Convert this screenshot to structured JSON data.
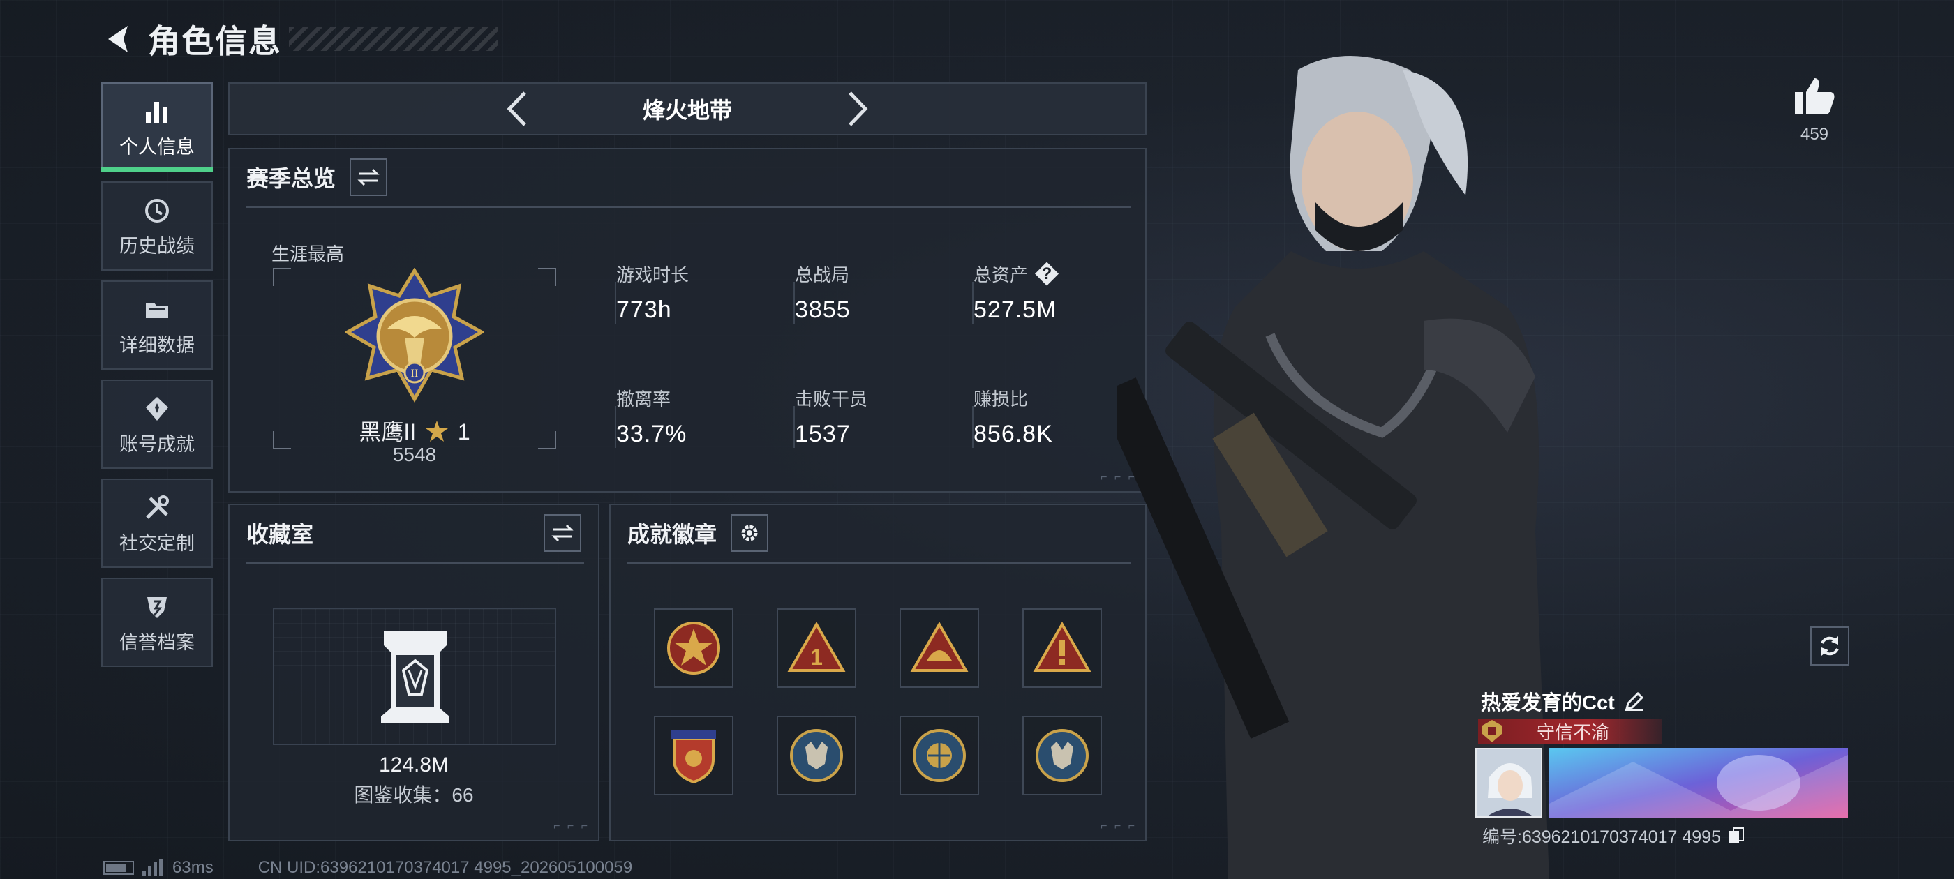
{
  "header": {
    "title": "角色信息"
  },
  "sidebar": {
    "items": [
      {
        "label": "个人信息",
        "icon": "bar-chart-icon",
        "active": true
      },
      {
        "label": "历史战绩",
        "icon": "history-icon",
        "active": false
      },
      {
        "label": "详细数据",
        "icon": "folder-icon",
        "active": false
      },
      {
        "label": "账号成就",
        "icon": "achievement-icon",
        "active": false
      },
      {
        "label": "社交定制",
        "icon": "tools-icon",
        "active": false
      },
      {
        "label": "信誉档案",
        "icon": "shield-icon",
        "active": false
      }
    ]
  },
  "season": {
    "name": "烽火地带"
  },
  "overview": {
    "title": "赛季总览",
    "career_label": "生涯最高",
    "rank": {
      "name": "黑鹰II",
      "star": "1",
      "score": "5548"
    },
    "stats": [
      {
        "label": "游戏时长",
        "value": "773h"
      },
      {
        "label": "总战局",
        "value": "3855"
      },
      {
        "label": "总资产",
        "value": "527.5M",
        "help": "?"
      },
      {
        "label": "撤离率",
        "value": "33.7%"
      },
      {
        "label": "击败干员",
        "value": "1537"
      },
      {
        "label": "赚损比",
        "value": "856.8K"
      }
    ]
  },
  "vault": {
    "title": "收藏室",
    "value": "124.8M",
    "collection": "图鉴收集：66"
  },
  "badges": {
    "title": "成就徽章",
    "items": [
      "red-star-medal-icon",
      "triangle-one-badge-icon",
      "triangle-helmet-badge-icon",
      "triangle-warning-badge-icon",
      "shield-stars-badge-icon",
      "wolf-coin-badge-icon",
      "ball-coin-badge-icon",
      "wolf-coin-badge-icon"
    ]
  },
  "profile": {
    "likes": "459",
    "player_name": "热爱发育的Cct",
    "title_text": "守信不渝",
    "uid_line": "编号:6396210170374017 4995"
  },
  "status_bar": {
    "ping": "63ms",
    "uid": "CN UID:6396210170374017 4995_202605100059"
  },
  "colors": {
    "accent_green": "#4fd08a",
    "title_red": "#a3272c",
    "panel_bg": "#202630"
  }
}
